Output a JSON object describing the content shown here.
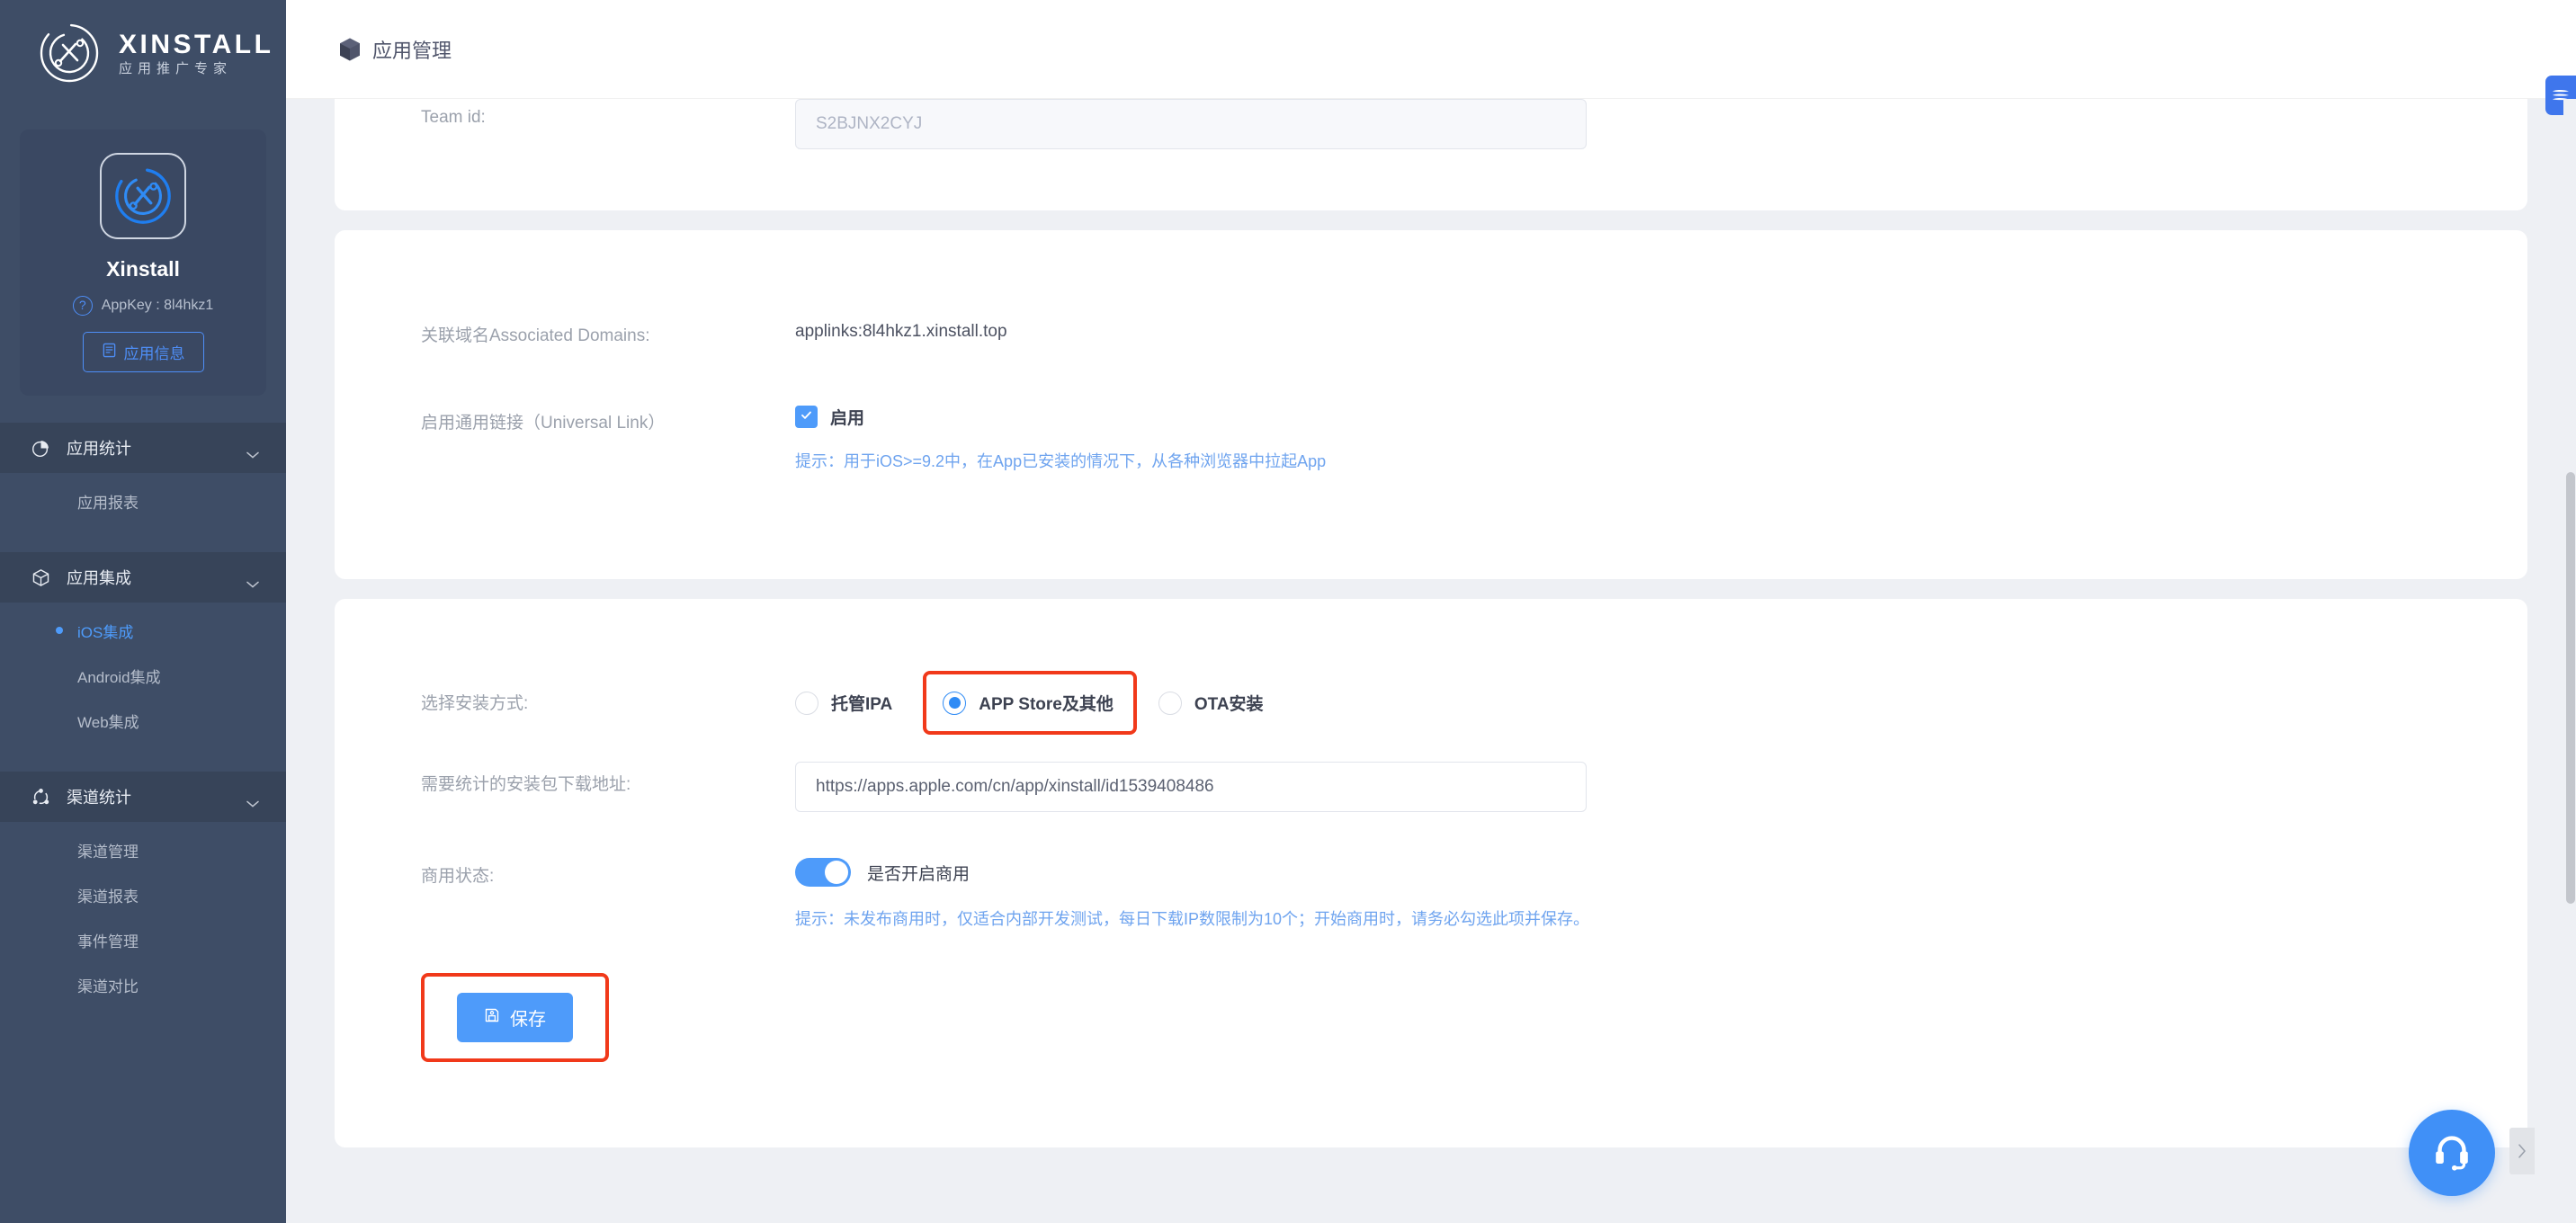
{
  "brand": {
    "name": "XINSTALL",
    "subtitle": "应用推广专家",
    "logo_icon": "xinstall-logo-icon"
  },
  "app_card": {
    "app_icon": "app-avatar-icon",
    "app_name": "Xinstall",
    "help_icon": "question-circle-icon",
    "app_key_label": "AppKey : 8l4hkz1",
    "info_button_icon": "document-icon",
    "info_button_label": "应用信息"
  },
  "sidebar": {
    "groups": [
      {
        "label": "应用统计",
        "icon": "pie-chart-icon",
        "chevron": "chevron-down-icon",
        "items": [
          {
            "label": "应用报表",
            "active": false
          }
        ]
      },
      {
        "label": "应用集成",
        "icon": "cube-icon",
        "chevron": "chevron-down-icon",
        "items": [
          {
            "label": "iOS集成",
            "active": true
          },
          {
            "label": "Android集成",
            "active": false
          },
          {
            "label": "Web集成",
            "active": false
          }
        ]
      },
      {
        "label": "渠道统计",
        "icon": "share-nodes-icon",
        "chevron": "chevron-down-icon",
        "items": [
          {
            "label": "渠道管理",
            "active": false
          },
          {
            "label": "渠道报表",
            "active": false
          },
          {
            "label": "事件管理",
            "active": false
          },
          {
            "label": "渠道对比",
            "active": false
          }
        ]
      }
    ]
  },
  "topbar": {
    "icon": "cube-solid-icon",
    "title": "应用管理"
  },
  "form": {
    "team_id": {
      "label": "Team id:",
      "value": "S2BJNX2CYJ"
    },
    "associated_domains": {
      "label": "关联域名Associated Domains:",
      "value": "applinks:8l4hkz1.xinstall.top"
    },
    "universal_link": {
      "label": "启用通用链接（Universal Link）",
      "checkbox_icon": "checkmark-icon",
      "checkbox_checked": true,
      "checkbox_label": "启用",
      "hint": "提示：用于iOS>=9.2中，在App已安装的情况下，从各种浏览器中拉起App"
    },
    "install_method": {
      "label": "选择安装方式:",
      "options": [
        {
          "label": "托管IPA",
          "checked": false,
          "highlighted": false
        },
        {
          "label": "APP Store及其他",
          "checked": true,
          "highlighted": true
        },
        {
          "label": "OTA安装",
          "checked": false,
          "highlighted": false
        }
      ]
    },
    "download_url": {
      "label": "需要统计的安装包下载地址:",
      "value": "https://apps.apple.com/cn/app/xinstall/id1539408486"
    },
    "commercial_status": {
      "label": "商用状态:",
      "toggle_on": true,
      "toggle_label": "是否开启商用",
      "hint": "提示：未发布商用时，仅适合内部开发测试，每日下载IP数限制为10个；开始商用时，请务必勾选此项并保存。"
    },
    "save": {
      "icon": "save-floppy-icon",
      "label": "保存",
      "highlighted": true
    }
  },
  "floating": {
    "support_icon": "headset-icon",
    "collapse_icon": "chevron-right-icon",
    "edge_badge_icon": "feedback-badge-icon"
  },
  "colors": {
    "sidebar_bg": "#3e4d66",
    "accent_blue": "#4e9bfa",
    "highlight_red": "#f1391a",
    "hint_blue": "#6fa4ef"
  }
}
